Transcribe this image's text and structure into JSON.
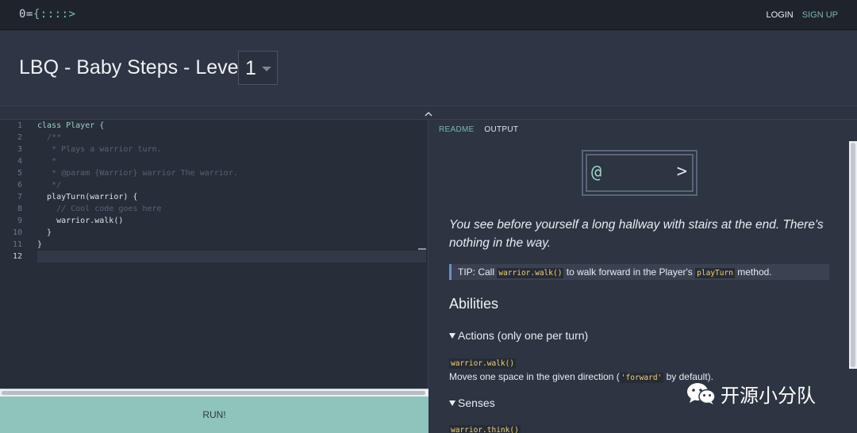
{
  "nav": {
    "logo_prefix": "0=",
    "logo_brace": "{",
    "logo_dots": "::::",
    "logo_suffix": ">",
    "login": "LOGIN",
    "signup": "SIGN UP"
  },
  "header": {
    "title": "LBQ - Baby Steps - Level",
    "level": "1"
  },
  "editor": {
    "line_numbers": [
      "1",
      "2",
      "3",
      "4",
      "5",
      "6",
      "7",
      "8",
      "9",
      "10",
      "11",
      "12"
    ],
    "lines": [
      "class Player {",
      "  /**",
      "   * Plays a warrior turn.",
      "   *",
      "   * @param {Warrior} warrior The warrior.",
      "   */",
      "  playTurn(warrior) {",
      "    // Cool code goes here",
      "    warrior.walk()",
      "  }",
      "}",
      ""
    ],
    "run_label": "RUN!"
  },
  "panel": {
    "tabs": [
      "README",
      "OUTPUT"
    ],
    "board": {
      "warrior": "@",
      "stairs": ">"
    },
    "description": "You see before yourself a long hallway with stairs at the end. There's nothing in the way.",
    "tip": {
      "prefix": "TIP: Call",
      "code1": "warrior.walk()",
      "middle": "to walk forward in the Player's",
      "code2": "playTurn",
      "suffix": "method."
    },
    "abilities_heading": "Abilities",
    "actions_heading": "Actions (only one per turn)",
    "walk_code": "warrior.walk()",
    "walk_desc_prefix": "Moves one space in the given direction (",
    "walk_desc_code": "'forward'",
    "walk_desc_suffix": " by default).",
    "senses_heading": "Senses",
    "think_code": "warrior.think()"
  },
  "watermark": {
    "icon": "wechat-icon",
    "text": "开源小分队"
  },
  "colors": {
    "accent": "#79b8ad",
    "run_button": "#8fc4bd",
    "background": "#2b3240"
  }
}
